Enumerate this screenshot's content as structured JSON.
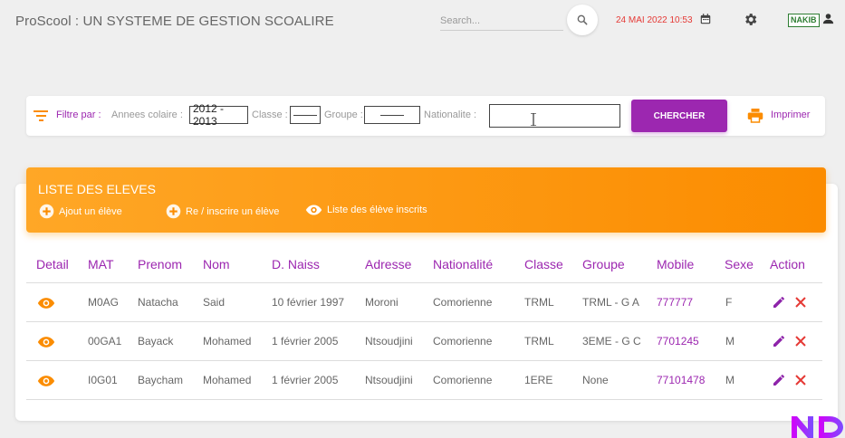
{
  "header": {
    "title": "ProScool : UN SYSTEME DE GESTION SCOALIRE",
    "search_placeholder": "Search...",
    "date": "24 MAI 2022 10:53",
    "user": "NAKIB"
  },
  "filter": {
    "label": "Filtre par :",
    "annee_label": "Annees colaire :",
    "annee_value": "2012 - 2013",
    "classe_label": "Classe :",
    "groupe_label": "Groupe :",
    "nationalite_label": "Nationalite :",
    "nationalite_value": "",
    "search_button": "CHERCHER",
    "print_label": "Imprimer"
  },
  "list": {
    "title": "LISTE DES ELEVES",
    "actions": [
      "Ajout un élève",
      "Re / inscrire un élève",
      "Liste des élève inscrits"
    ]
  },
  "table": {
    "columns": [
      "Detail",
      "MAT",
      "Prenom",
      "Nom",
      "D. Naiss",
      "Adresse",
      "Nationalité",
      "Classe",
      "Groupe",
      "Mobile",
      "Sexe",
      "Action"
    ],
    "rows": [
      {
        "mat": "M0AG",
        "prenom": "Natacha",
        "nom": "Said",
        "naiss": "10 février 1997",
        "adresse": "Moroni",
        "nationalite": "Comorienne",
        "classe": "TRML",
        "groupe": "TRML - G A",
        "mobile": "777777",
        "sexe": "F"
      },
      {
        "mat": "00GA1",
        "prenom": "Bayack",
        "nom": "Mohamed",
        "naiss": "1 février 2005",
        "adresse": "Ntsoudjini",
        "nationalite": "Comorienne",
        "classe": "TRML",
        "groupe": "3EME - G C",
        "mobile": "7701245",
        "sexe": "M"
      },
      {
        "mat": "I0G01",
        "prenom": "Baycham",
        "nom": "Mohamed",
        "naiss": "1 février 2005",
        "adresse": "Ntsoudjini",
        "nationalite": "Comorienne",
        "classe": "1ERE",
        "groupe": "None",
        "mobile": "77101478",
        "sexe": "M"
      }
    ]
  },
  "colors": {
    "accent": "#9c27b0",
    "orange": "#fb8c00",
    "date_red": "#e53935",
    "badge_green": "#2e7d32",
    "delete_red": "#e53935"
  }
}
